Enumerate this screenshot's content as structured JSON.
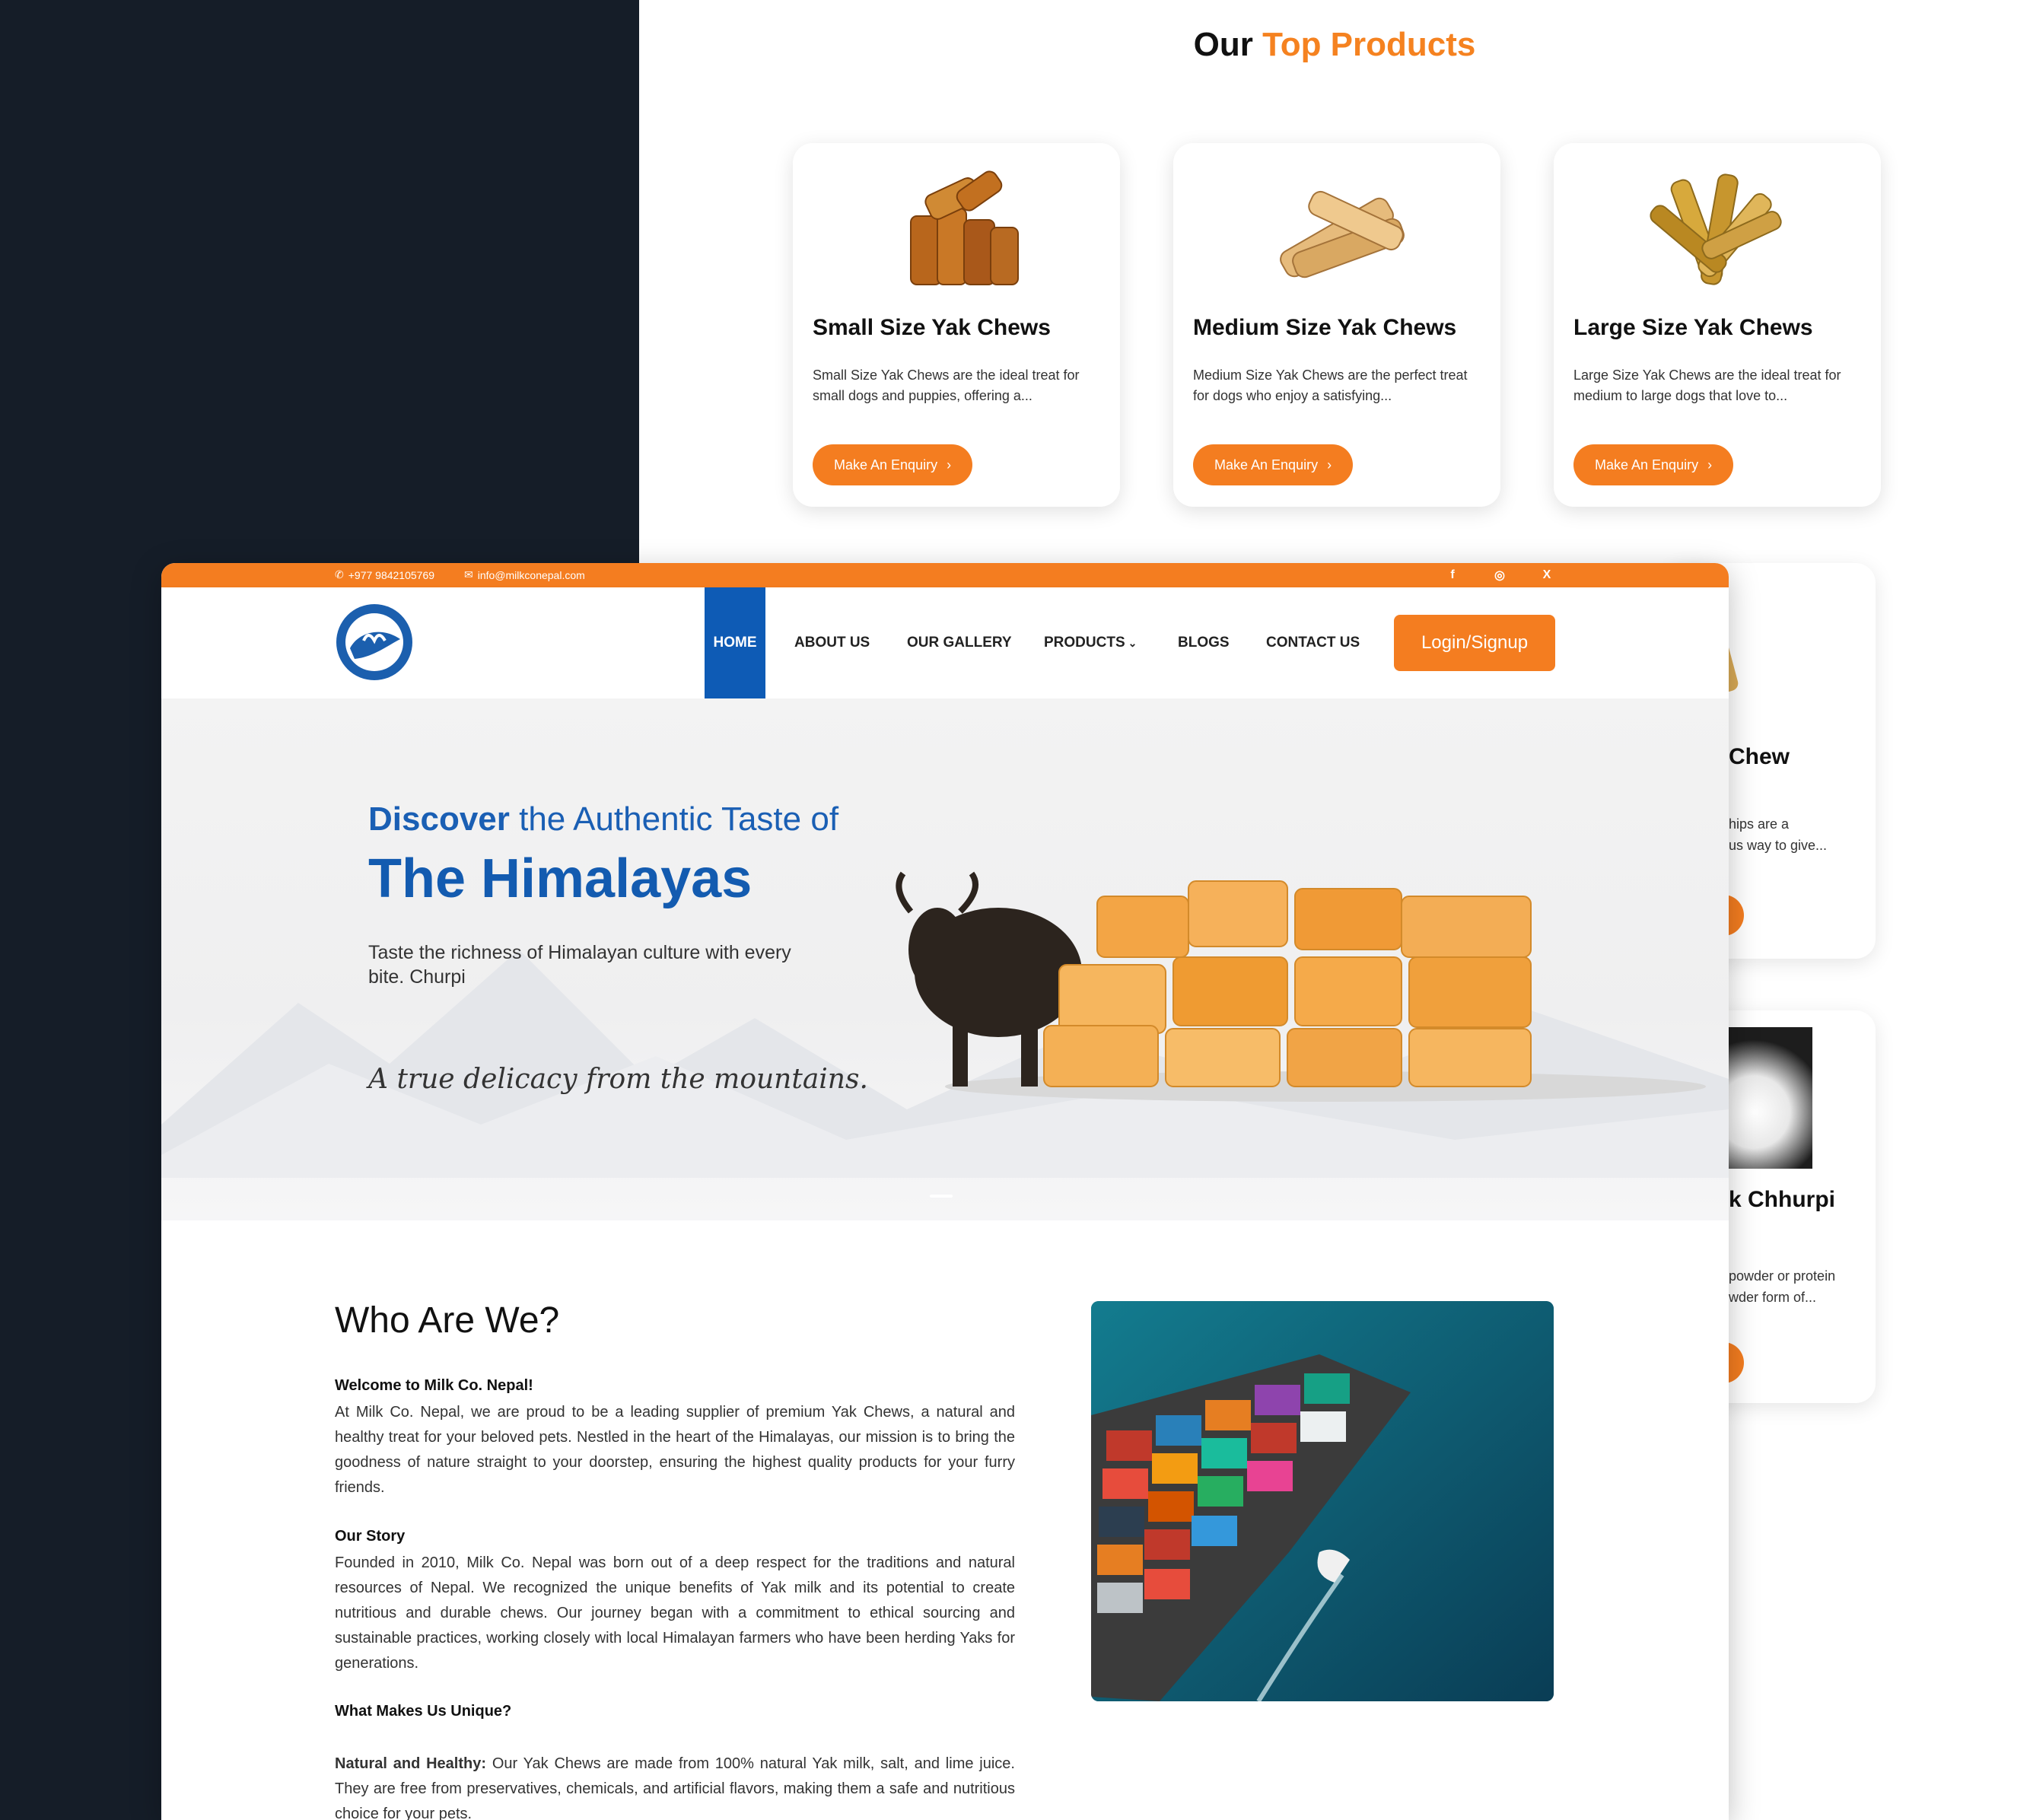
{
  "colors": {
    "accent": "#f47d20",
    "brand_blue": "#135bb0",
    "dark": "#151d28"
  },
  "top_products": {
    "title_prefix": "Our",
    "title_accent": "Top Products",
    "cards": [
      {
        "name": "Small Size Yak Chews",
        "desc": "Small Size Yak Chews are the ideal treat for small dogs and puppies, offering a...",
        "button": "Make An Enquiry",
        "icon": "chevron-right-icon"
      },
      {
        "name": "Medium Size Yak Chews",
        "desc": "Medium Size Yak Chews are the perfect treat for dogs who enjoy a satisfying...",
        "button": "Make An Enquiry",
        "icon": "chevron-right-icon"
      },
      {
        "name": "Large Size Yak Chews",
        "desc": "Large Size Yak Chews are the ideal treat for medium to large dogs that love to...",
        "button": "Make An Enquiry",
        "icon": "chevron-right-icon"
      }
    ],
    "partial_cards": [
      {
        "name": "Chew",
        "desc_line1": "hips are a",
        "desc_line2": "us way to give..."
      },
      {
        "name": "k Chhurpi",
        "desc_line1": "powder or protein",
        "desc_line2": "wder form of..."
      }
    ]
  },
  "site": {
    "topbar": {
      "phone": "+977 9842105769",
      "email": "info@milkconepal.com",
      "social": [
        "facebook-icon",
        "instagram-icon",
        "x-icon"
      ],
      "social_glyphs": [
        "f",
        "◎",
        "X"
      ]
    },
    "nav": {
      "items": [
        "HOME",
        "ABOUT US",
        "OUR GALLERY",
        "PRODUCTS",
        "BLOGS",
        "CONTACT US"
      ],
      "products_caret": "⌄",
      "login": "Login/Signup"
    },
    "hero": {
      "line1_bold": "Discover",
      "line1_rest": " the Authentic Taste of",
      "line2": "The Himalayas",
      "tagline": "Taste the richness of Himalayan culture with every bite. Churpi",
      "script": "A true delicacy from the mountains."
    },
    "about": {
      "title": "Who Are We?",
      "welcome": "Welcome to Milk Co. Nepal!",
      "p1": "At Milk Co. Nepal, we are proud to be a leading supplier of premium Yak Chews, a natural and healthy treat for your beloved pets. Nestled in the heart of the Himalayas, our mission is to bring the goodness of nature straight to your doorstep, ensuring the highest quality products for your furry friends.",
      "story_title": "Our Story",
      "p2": "Founded in 2010, Milk Co. Nepal was born out of a deep respect for the traditions and natural resources of Nepal. We recognized the unique benefits of Yak milk and its potential to create nutritious and durable chews. Our journey began with a commitment to ethical sourcing and sustainable practices, working closely with local Himalayan farmers who have been herding Yaks for generations.",
      "unique_title": "What Makes Us Unique?",
      "p3_bold": "Natural and Healthy:",
      "p3": " Our Yak Chews are made from 100% natural Yak milk, salt, and lime juice. They are free from preservatives, chemicals, and artificial flavors, making them a safe and nutritious choice for your pets."
    }
  }
}
